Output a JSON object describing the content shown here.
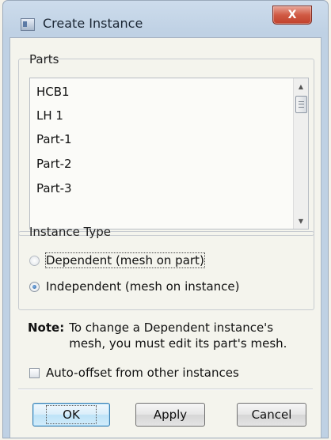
{
  "window": {
    "title": "Create Instance",
    "close_glyph": "X"
  },
  "parts": {
    "label": "Parts",
    "items": [
      "HCB1",
      "LH 1",
      "Part-1",
      "Part-2",
      "Part-3"
    ],
    "scroll_up_glyph": "▲",
    "scroll_down_glyph": "▼"
  },
  "instance_type": {
    "label": "Instance Type",
    "options": [
      {
        "label": "Dependent (mesh on part)",
        "selected": false
      },
      {
        "label": "Independent (mesh on instance)",
        "selected": true
      }
    ]
  },
  "note": {
    "prefix": "Note:",
    "text": "To change a Dependent instance's mesh, you must edit its part's mesh."
  },
  "auto_offset": {
    "label": "Auto-offset from other instances",
    "checked": false
  },
  "buttons": {
    "ok": "OK",
    "apply": "Apply",
    "cancel": "Cancel"
  },
  "colors": {
    "title_bar": "#c8d8ea",
    "close_button": "#d05a44",
    "default_button_border": "#3c7fb1",
    "dialog_background": "#f4f2ea"
  }
}
